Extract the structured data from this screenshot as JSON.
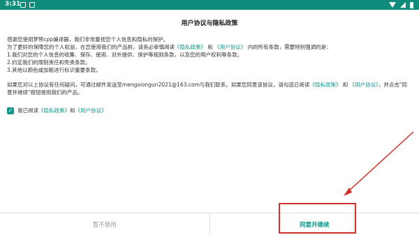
{
  "status_bar": {
    "time": "3:31"
  },
  "dialog": {
    "title": "用户协议与隐私政策",
    "greeting": "感谢您使用梦熊cpp编译器，我们非常重视您个人信息和隐私的保护。",
    "intro_prefix": "为了更好的保障您的个人权益，在您使用我们的产品前，请务必审慎阅读",
    "privacy_link": "《隐私政策》",
    "and": "和",
    "user_link": "《用户协议》",
    "intro_suffix": "内的所有条款，需要特别强调的是：",
    "points": [
      "1.我们对您的个人信息的收集、保存、使用、对外提供、保护等规则条款，以及您的用户权利等条款。",
      "2.约定我们的限制责任和免责条款。",
      "3.其他以颜色或加粗进行标识重要条款。"
    ],
    "contact_prefix": "如果您对以上协议有任何疑问，可通过邮件发送至mengxiongun2021@163.com与我们联系。如果您同意该协议，请勾选已阅读",
    "contact_mid": "，并点击\"同",
    "contact_line2": "意并继续\"按钮使用我们的产品。",
    "consent_prefix": "我已阅读",
    "consent_checked": true
  },
  "buttons": {
    "decline": "暂不使用",
    "agree": "同意并继续"
  },
  "colors": {
    "status_bar": "#0f8c7c",
    "accent": "#12968a",
    "annotation": "#d0302a"
  }
}
